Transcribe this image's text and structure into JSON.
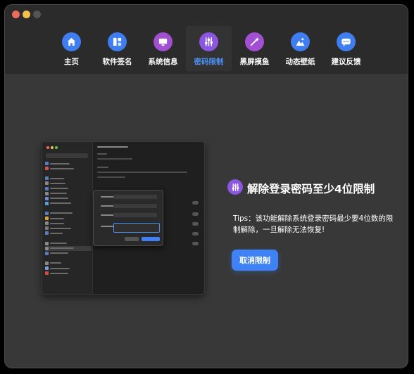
{
  "nav": [
    {
      "label": "主页",
      "icon": "home-icon",
      "color": "#3e7ef0"
    },
    {
      "label": "软件签名",
      "icon": "signature-icon",
      "color": "#3e7ef0"
    },
    {
      "label": "系统信息",
      "icon": "system-info-icon",
      "color": "#a24fd1"
    },
    {
      "label": "密码限制",
      "icon": "sliders-icon",
      "color": "#8a56e2",
      "active": true
    },
    {
      "label": "黑屏摸鱼",
      "icon": "magic-wand-icon",
      "color": "#a24fd1"
    },
    {
      "label": "动态壁纸",
      "icon": "wallpaper-icon",
      "color": "#3e7ef0"
    },
    {
      "label": "建议反馈",
      "icon": "feedback-icon",
      "color": "#3e7ef0"
    }
  ],
  "main": {
    "heading": "解除登录密码至少4位限制",
    "tips": "Tips：该功能解除系统登录密码最少要4位数的限制解除，一旦解除无法恢复!",
    "cancel_label": "取消限制"
  },
  "colors": {
    "accent": "#3e82f5",
    "purple": "#8a56e2",
    "background": "#383838"
  }
}
